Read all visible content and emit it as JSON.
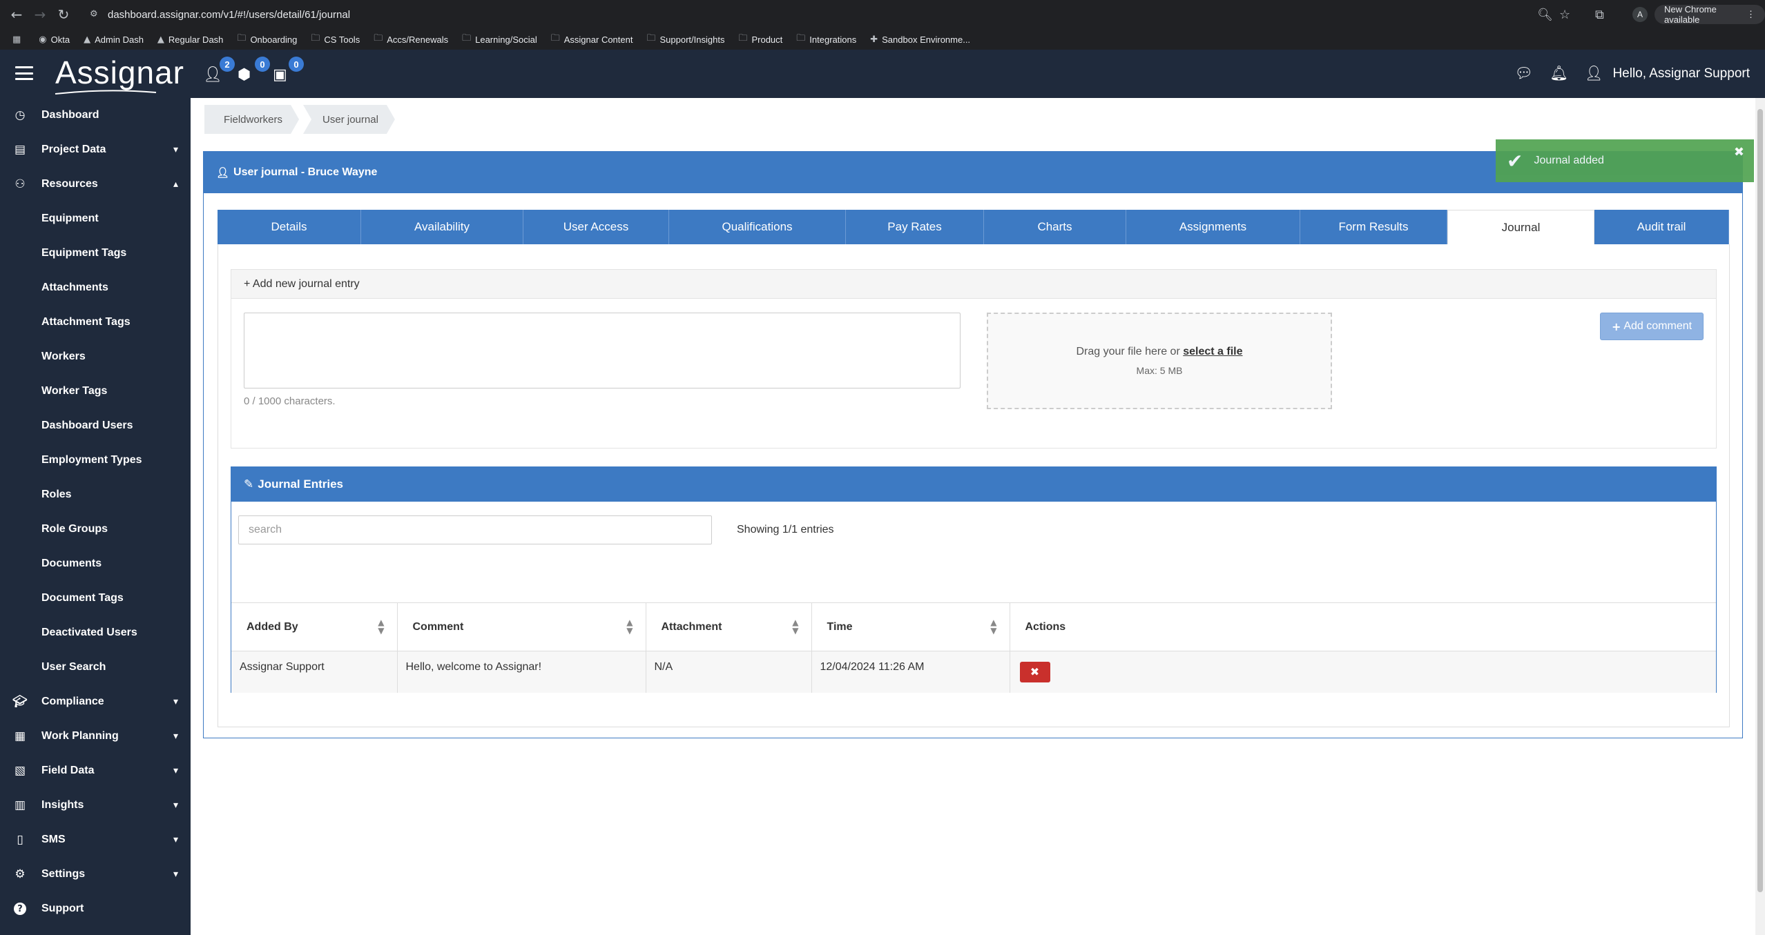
{
  "browser": {
    "url": "dashboard.assignar.com/v1/#!/users/detail/61/journal",
    "profile_initial": "A",
    "update_label": "New Chrome available",
    "bookmarks": [
      "Okta",
      "Admin Dash",
      "Regular Dash",
      "Onboarding",
      "CS Tools",
      "Accs/Renewals",
      "Learning/Social",
      "Assignar Content",
      "Support/Insights",
      "Product",
      "Integrations",
      "Sandbox Environme..."
    ]
  },
  "header": {
    "logo": "Assignar",
    "badges": {
      "people": "2",
      "box": "0",
      "bag": "0"
    },
    "greeting": "Hello, Assignar Support"
  },
  "sidebar": {
    "top": [
      {
        "label": "Dashboard",
        "icon": "dashboard-icon"
      },
      {
        "label": "Project Data",
        "icon": "briefcase-icon"
      },
      {
        "label": "Resources",
        "icon": "resources-icon"
      }
    ],
    "resources_sub": [
      "Equipment",
      "Equipment Tags",
      "Attachments",
      "Attachment Tags",
      "Workers",
      "Worker Tags",
      "Dashboard Users",
      "Employment Types",
      "Roles",
      "Role Groups",
      "Documents",
      "Document Tags",
      "Deactivated Users",
      "User Search"
    ],
    "bottom": [
      {
        "label": "Compliance",
        "icon": "graduation-cap-icon"
      },
      {
        "label": "Work Planning",
        "icon": "calendar-icon"
      },
      {
        "label": "Field Data",
        "icon": "clipboard-icon"
      },
      {
        "label": "Insights",
        "icon": "bar-chart-icon"
      },
      {
        "label": "SMS",
        "icon": "mobile-icon"
      },
      {
        "label": "Settings",
        "icon": "gear-icon"
      },
      {
        "label": "Support",
        "icon": "question-icon"
      }
    ]
  },
  "breadcrumb": [
    "Fieldworkers",
    "User journal"
  ],
  "panel": {
    "title": "User journal - Bruce Wayne"
  },
  "tabs": [
    "Details",
    "Availability",
    "User Access",
    "Qualifications",
    "Pay Rates",
    "Charts",
    "Assignments",
    "Form Results",
    "Journal",
    "Audit trail"
  ],
  "active_tab": "Journal",
  "new_entry": {
    "title": "+ Add new journal entry",
    "char_count": "0 / 1000 characters.",
    "drop_text": "Drag your file here or",
    "drop_link": "select a file",
    "max_size": "Max: 5 MB",
    "add_button": "Add comment"
  },
  "entries": {
    "title": "Journal Entries",
    "search_placeholder": "search",
    "showing": "Showing 1/1 entries",
    "columns": [
      "Added By",
      "Comment",
      "Attachment",
      "Time",
      "Actions"
    ],
    "rows": [
      {
        "added_by": "Assignar Support",
        "comment": "Hello, welcome to Assignar!",
        "attachment": "N/A",
        "time": "12/04/2024 11:26 AM"
      }
    ]
  },
  "toast": {
    "message": "Journal added"
  },
  "colors": {
    "brand_blue": "#3d7ac3",
    "sidebar_bg": "#1f2a3c",
    "toast_green": "#51a351",
    "delete_red": "#c9302c"
  }
}
